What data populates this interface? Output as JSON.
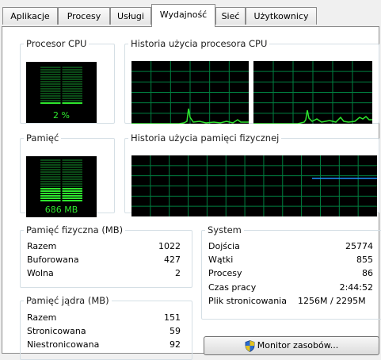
{
  "tabs": [
    "Aplikacje",
    "Procesy",
    "Usługi",
    "Wydajność",
    "Sieć",
    "Użytkownicy"
  ],
  "active_tab": "Wydajność",
  "cpu": {
    "title": "Procesor CPU",
    "value": "2 %",
    "usage_fraction": 0.02
  },
  "cpu_history": {
    "title": "Historia użycia procesora CPU"
  },
  "memory": {
    "title": "Pamięć",
    "value": "686 MB",
    "usage_fraction": 0.34
  },
  "memory_history": {
    "title": "Historia użycia pamięci fizycznej"
  },
  "physical_memory": {
    "title": "Pamięć fizyczna (MB)",
    "rows": [
      {
        "label": "Razem",
        "value": "1022"
      },
      {
        "label": "Buforowana",
        "value": "427"
      },
      {
        "label": "Wolna",
        "value": "2"
      }
    ]
  },
  "kernel_memory": {
    "title": "Pamięć jądra (MB)",
    "rows": [
      {
        "label": "Razem",
        "value": "151"
      },
      {
        "label": "Stronicowana",
        "value": "59"
      },
      {
        "label": "Niestronicowana",
        "value": "92"
      }
    ]
  },
  "system": {
    "title": "System",
    "rows": [
      {
        "label": "Dojścia",
        "value": "25774"
      },
      {
        "label": "Wątki",
        "value": "855"
      },
      {
        "label": "Procesy",
        "value": "86"
      },
      {
        "label": "Czas pracy",
        "value": "2:44:52"
      },
      {
        "label": "Plik stronicowania",
        "value": "1256M / 2295M"
      }
    ]
  },
  "resource_monitor_button": "Monitor zasobów...",
  "colors": {
    "grid": "#008040",
    "cpu_line": "#2ee62e",
    "mem_line": "#1e90ff",
    "gauge_on": "#2ee62e",
    "gauge_off": "#0b4a17"
  }
}
